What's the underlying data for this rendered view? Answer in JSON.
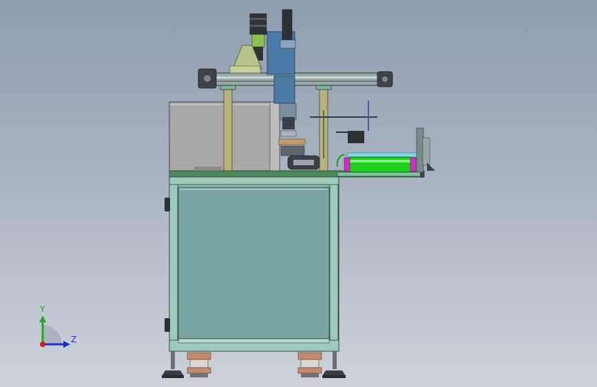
{
  "axes_triad": {
    "y_label": "Y",
    "z_label": "Z",
    "colors": {
      "y": "#1faa1f",
      "z": "#1c2fd6",
      "x": "#d01919"
    }
  },
  "colors": {
    "background_top": "#8f9db0",
    "background_bottom": "#cdd2d9",
    "frame_panel": "#7aa7a3",
    "frame_profile": "#8cc0b3",
    "green_deck": "#4c8a5c",
    "enclosure_gray": "#a9a9a9",
    "blue_bracket": "#4a7aa6",
    "green_roller": "#1fce1f",
    "magenta_cap": "#d02fc4",
    "post_tan": "#b7b27a",
    "motor_dark": "#2f3338"
  },
  "parts": [
    "machine-base-frame",
    "base-panel",
    "leveling-foot",
    "caster-wheel",
    "top-deck-plate",
    "side-enclosure",
    "support-post",
    "gantry-beam",
    "stepper-motor",
    "z-axis-bracket",
    "spindle-head",
    "tool-assembly",
    "roller-conveyor",
    "end-plate-assembly"
  ]
}
